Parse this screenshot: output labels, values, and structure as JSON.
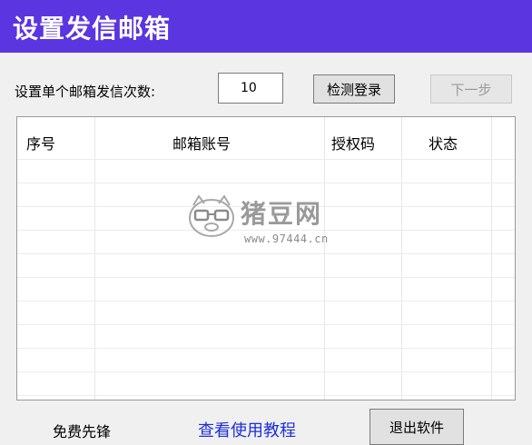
{
  "window": {
    "title": "设置发信邮箱",
    "accent_color": "#5a35e0"
  },
  "form": {
    "count_label": "设置单个邮箱发信次数:",
    "count_value": "10",
    "check_login_button": "检测登录",
    "next_button": "下一步"
  },
  "table": {
    "columns": [
      "序号",
      "邮箱账号",
      "授权码",
      "状态"
    ],
    "rows": []
  },
  "watermark": {
    "brand": "猪豆网",
    "url": "www.97444.cn",
    "icon": "pig-with-glasses-icon"
  },
  "footer": {
    "free_label": "免费先锋",
    "tutorial_link": "查看使用教程",
    "exit_button": "退出软件",
    "link_color": "#1d2fd8"
  }
}
